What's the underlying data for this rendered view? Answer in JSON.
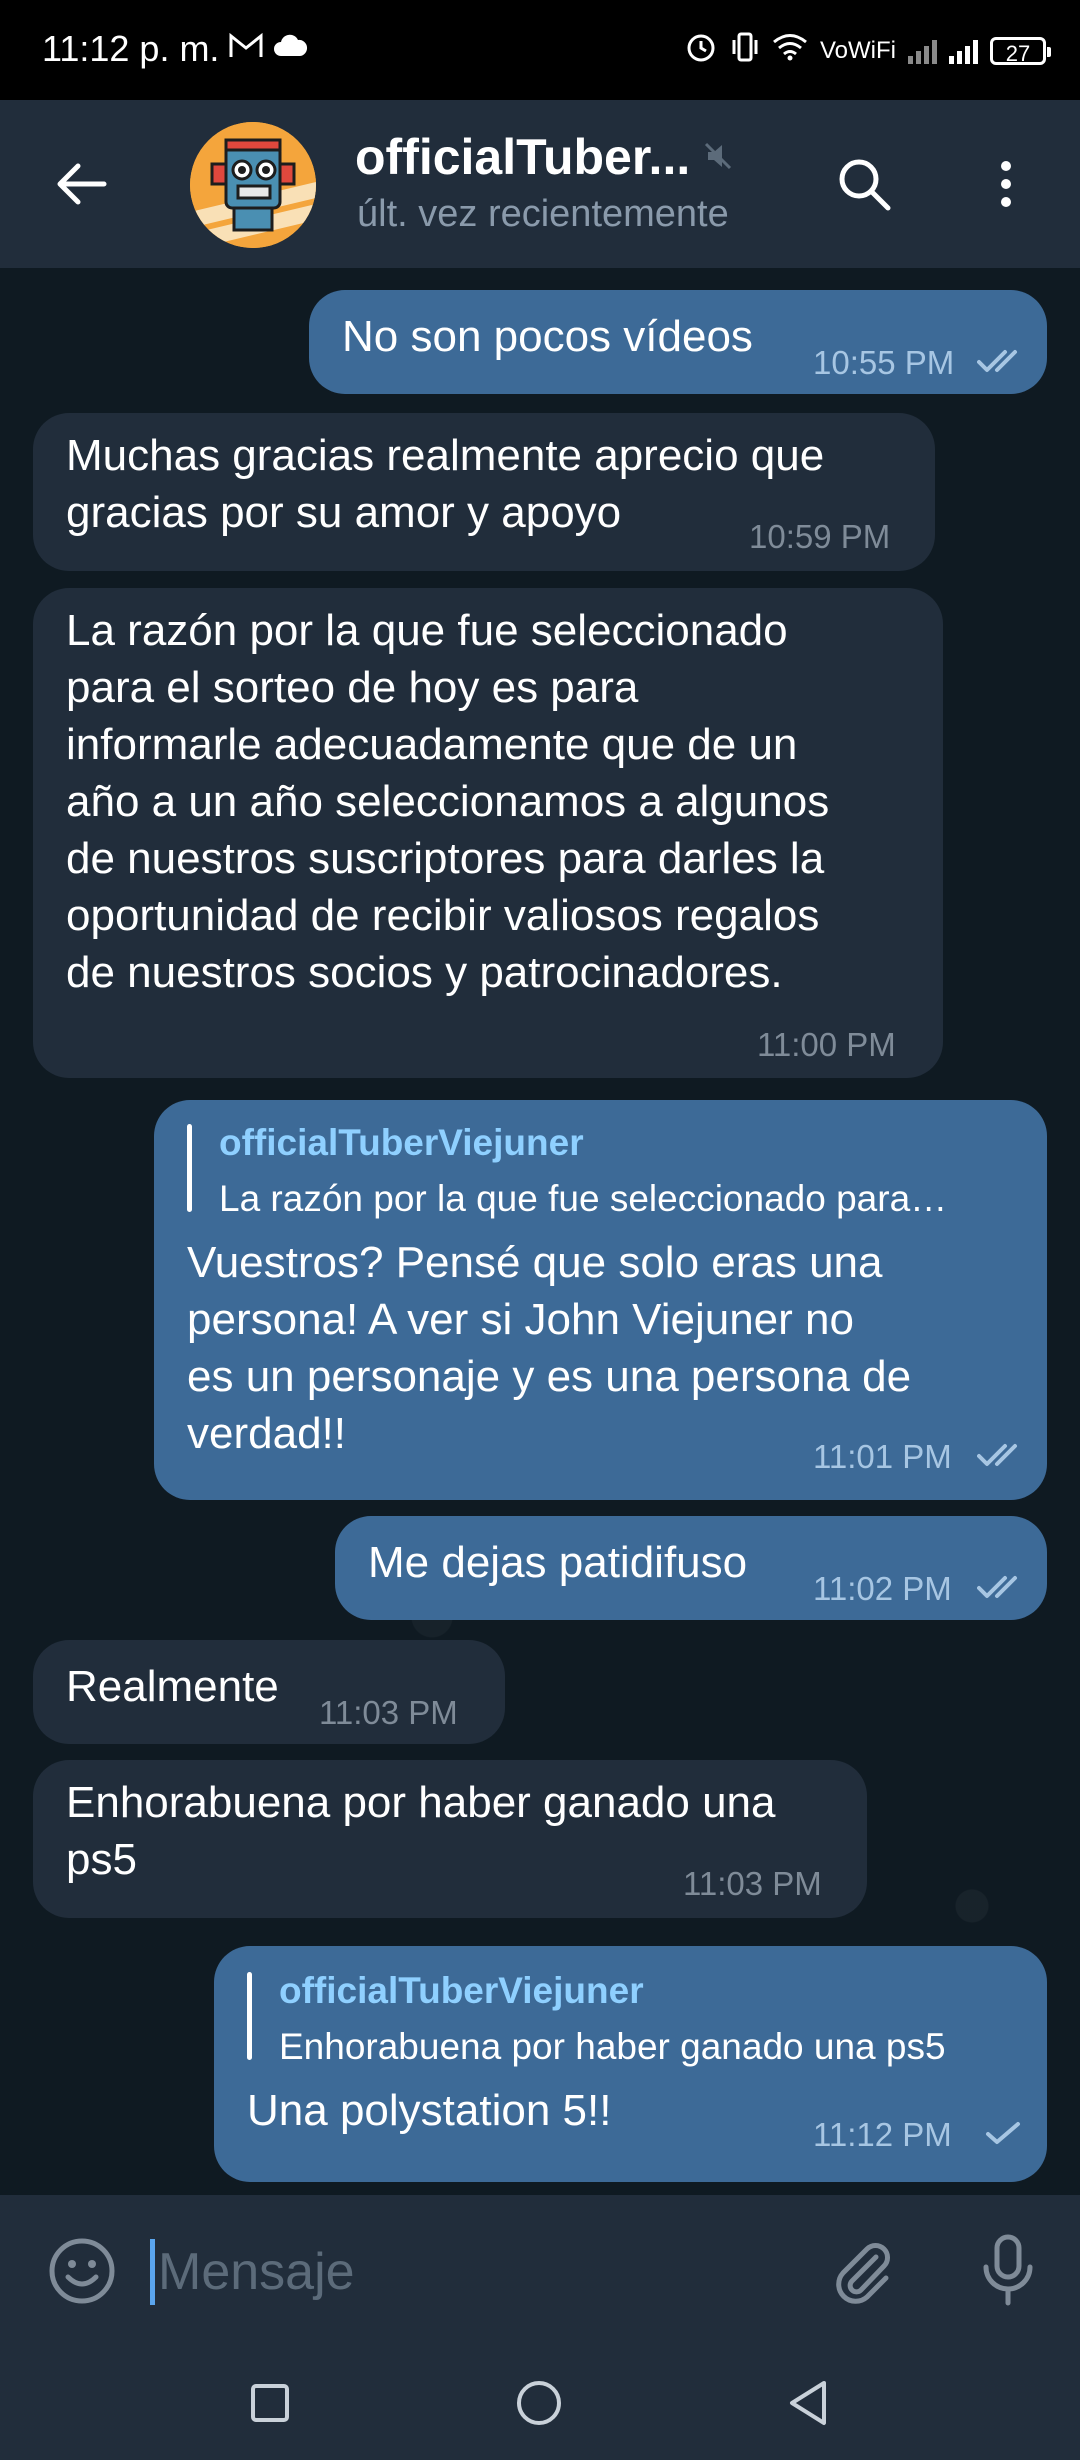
{
  "status_bar": {
    "time": "11:12 p. m.",
    "network": "VoWiFi",
    "battery": "27"
  },
  "header": {
    "title": "officialTuber...",
    "status": "últ. vez recientemente",
    "icons": [
      "back-arrow-icon",
      "mute-icon",
      "search-icon",
      "more-vert-icon"
    ]
  },
  "messages": [
    {
      "direction": "out",
      "lines": [
        "No son pocos vídeos"
      ],
      "time": "10:55 PM",
      "ticks": "double"
    },
    {
      "direction": "in",
      "lines": [
        "Muchas gracias realmente aprecio que",
        "gracias por su amor y apoyo"
      ],
      "time": "10:59 PM"
    },
    {
      "direction": "in",
      "lines": [
        "La razón por la que fue seleccionado",
        "para el sorteo de hoy es para",
        "informarle adecuadamente que de un",
        "año a un año seleccionamos a algunos",
        "de nuestros suscriptores para darles la",
        "oportunidad de recibir valiosos regalos",
        "de nuestros socios y patrocinadores."
      ],
      "time": "11:00 PM"
    },
    {
      "direction": "out",
      "reply_name": "officialTuberViejuner",
      "reply_text": "La razón por la que fue seleccionado para…",
      "lines": [
        "Vuestros? Pensé que solo eras una",
        "persona! A ver si John Viejuner no",
        "es un personaje y es una persona de",
        "verdad!!"
      ],
      "time": "11:01 PM",
      "ticks": "double"
    },
    {
      "direction": "out",
      "lines": [
        "Me dejas patidifuso"
      ],
      "time": "11:02 PM",
      "ticks": "double"
    },
    {
      "direction": "in",
      "lines": [
        "Realmente"
      ],
      "time": "11:03 PM"
    },
    {
      "direction": "in",
      "lines": [
        "Enhorabuena por haber ganado una",
        "ps5"
      ],
      "time": "11:03 PM"
    },
    {
      "direction": "out",
      "reply_name": "officialTuberViejuner",
      "reply_text": "Enhorabuena por haber ganado una ps5",
      "lines": [
        "Una polystation 5!!"
      ],
      "time": "11:12 PM",
      "ticks": "single"
    }
  ],
  "composer": {
    "placeholder": "Mensaje"
  },
  "colors": {
    "header_bg": "#212d3b",
    "chat_bg": "#0f1a22",
    "incoming_bubble": "#212d3b",
    "outgoing_bubble": "#3d6a97",
    "reply_name": "#8fd0ff",
    "accent": "#5aa5ee"
  }
}
